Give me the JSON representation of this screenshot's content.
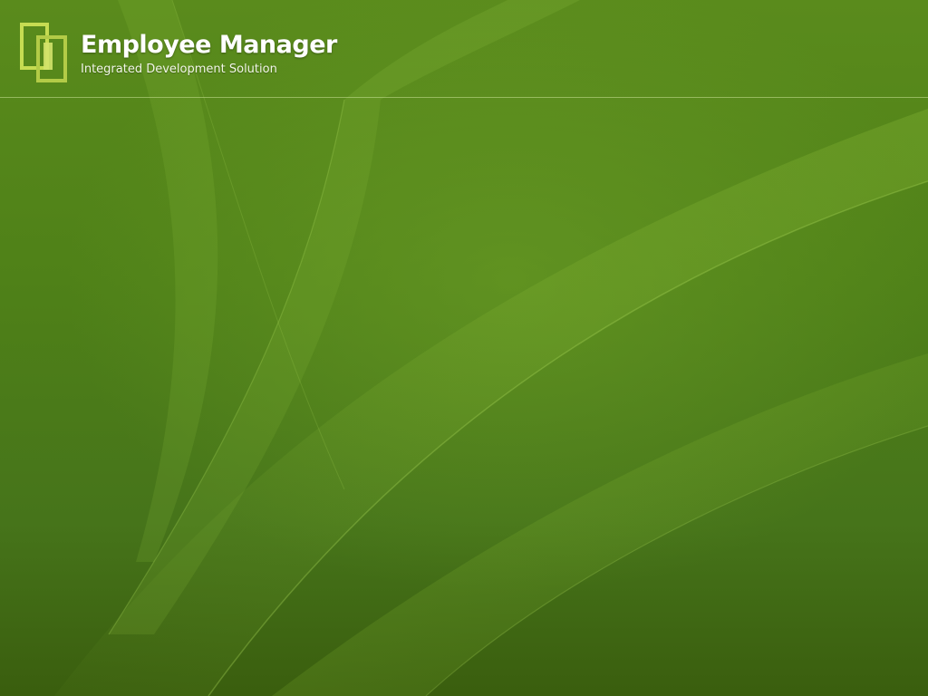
{
  "header": {
    "logo_icon": "app-logo-icon",
    "title": "Employee Manager",
    "subtitle": "Integrated Development Solution"
  },
  "colors": {
    "background": "#4e7f17",
    "logo": "#c6dc52",
    "text": "#ffffff"
  }
}
